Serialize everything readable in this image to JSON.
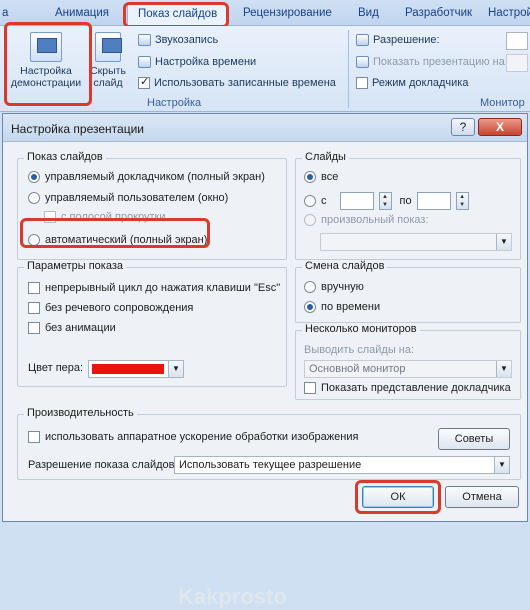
{
  "ribbon": {
    "tabs": [
      "а",
      "Анимация",
      "Показ слайдов",
      "Рецензирование",
      "Вид",
      "Разработчик",
      "Настройки"
    ],
    "setup_button": "Настройка демонстрации",
    "hide_slide_button": "Скрыть слайд",
    "record_narration": "Звукозапись",
    "rehearse_timings": "Настройка времени",
    "use_timings": "Использовать записанные времена",
    "group_setup": "Настройка",
    "resolution": "Разрешение:",
    "show_on": "Показать презентацию на:",
    "presenter_view": "Режим докладчика",
    "group_monitors": "Монитор"
  },
  "dialog": {
    "title": "Настройка презентации",
    "help": "?",
    "close": "X",
    "show_type": {
      "legend": "Показ слайдов",
      "option1": "управляемый докладчиком (полный экран)",
      "option2": "управляемый пользователем (окно)",
      "option2_sub": "с полосой прокрутки",
      "option3": "автоматический (полный экран)"
    },
    "slides": {
      "legend": "Слайды",
      "all": "все",
      "from": "с",
      "to": "по",
      "custom": "произвольный показ:"
    },
    "options": {
      "legend": "Параметры показа",
      "loop": "непрерывный цикл до нажатия клавиши \"Esc\"",
      "no_narration": "без речевого сопровождения",
      "no_animation": "без анимации",
      "pen_color": "Цвет пера:"
    },
    "advance": {
      "legend": "Смена слайдов",
      "manual": "вручную",
      "timings": "по времени"
    },
    "monitors": {
      "legend": "Несколько мониторов",
      "display_on": "Выводить слайды на:",
      "monitor": "Основной монитор",
      "presenter_view": "Показать представление докладчика"
    },
    "performance": {
      "legend": "Производительность",
      "hw_accel": "использовать аппаратное ускорение обработки изображения",
      "tips": "Советы",
      "resolution": "Разрешение показа слайдов:",
      "resolution_value": "Использовать текущее разрешение"
    },
    "ok": "ОК",
    "cancel": "Отмена"
  },
  "colors": {
    "pen": "#e8140f",
    "highlight": "#d93a2b"
  },
  "watermark": "Kakprosto"
}
